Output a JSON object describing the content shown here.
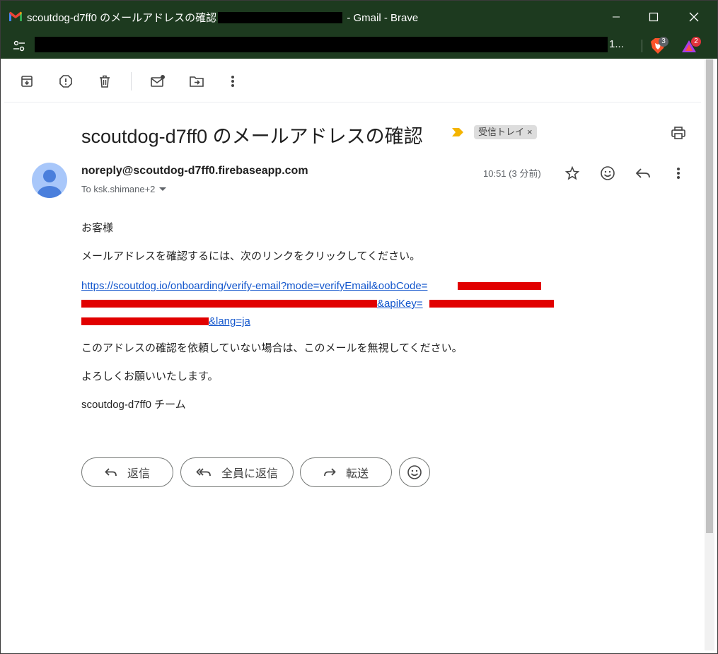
{
  "window": {
    "title_prefix": "scoutdog-d7ff0 のメールアドレスの確認",
    "title_suffix": "- Gmail - Brave",
    "url_tail": "1..."
  },
  "extensions": {
    "brave_badge": "3",
    "rewards_badge": "2"
  },
  "email": {
    "subject": "scoutdog-d7ff0 のメールアドレスの確認",
    "label": "受信トレイ",
    "sender": "noreply@scoutdog-d7ff0.firebaseapp.com",
    "to": "To ksk.shimane+2",
    "time": "10:51 (3 分前)",
    "greeting": "お客様",
    "line1": "メールアドレスを確認するには、次のリンクをクリックしてください。",
    "link_line1": "https://scoutdog.io/onboarding/verify-email?mode=verifyEmail&oobCode=",
    "link_line2_part": "&apiKey=",
    "link_line3_part": "&lang=ja",
    "line2": "このアドレスの確認を依頼していない場合は、このメールを無視してください。",
    "line3": "よろしくお願いいたします。",
    "signature": "scoutdog-d7ff0 チーム"
  },
  "actions": {
    "reply": "返信",
    "reply_all": "全員に返信",
    "forward": "転送"
  },
  "colors": {
    "titlebar": "#1d3a1f",
    "link": "#1155cc",
    "important": "#f4b400",
    "avatar": "#a8c7fa"
  }
}
